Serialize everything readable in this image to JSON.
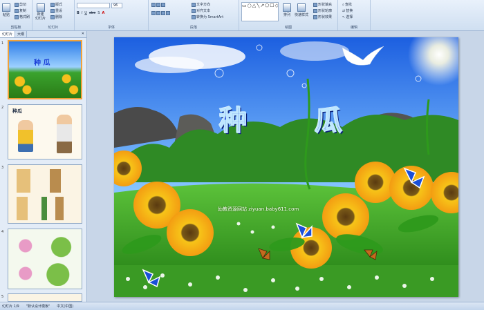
{
  "ribbon": {
    "clipboard": {
      "paste": "粘贴",
      "cut": "剪切",
      "copy": "复制",
      "format_painter": "格式刷",
      "label": "剪贴板"
    },
    "slides": {
      "new_slide": "新建\n幻灯片",
      "layout": "版式",
      "reset": "重设",
      "delete": "删除",
      "label": "幻灯片"
    },
    "font": {
      "size": "96",
      "label": "字体"
    },
    "paragraph": {
      "text_direction": "文字方向",
      "align_text": "对齐文本",
      "smartart": "转换为 SmartArt",
      "label": "段落"
    },
    "drawing": {
      "arrange": "排列",
      "quick_styles": "快速样式",
      "shape_fill": "形状填充",
      "shape_outline": "形状轮廓",
      "shape_effects": "形状效果",
      "label": "绘图"
    },
    "editing": {
      "find": "查找",
      "replace": "替换",
      "select": "选择",
      "label": "编辑"
    }
  },
  "panel": {
    "tabs": [
      "幻灯片",
      "大纲"
    ],
    "slide_numbers": [
      "1",
      "2",
      "3",
      "4",
      "5"
    ],
    "slide1_title": "种 瓜",
    "slide2_title": "种瓜"
  },
  "slide": {
    "title_left": "种",
    "title_right": "瓜",
    "watermark": "幼教资源网站 ziyuan.baby611.com"
  },
  "status": {
    "slide_counter": "幻灯片 1/9",
    "theme": "\"默认设计模板\"",
    "language": "中文(中国)"
  }
}
